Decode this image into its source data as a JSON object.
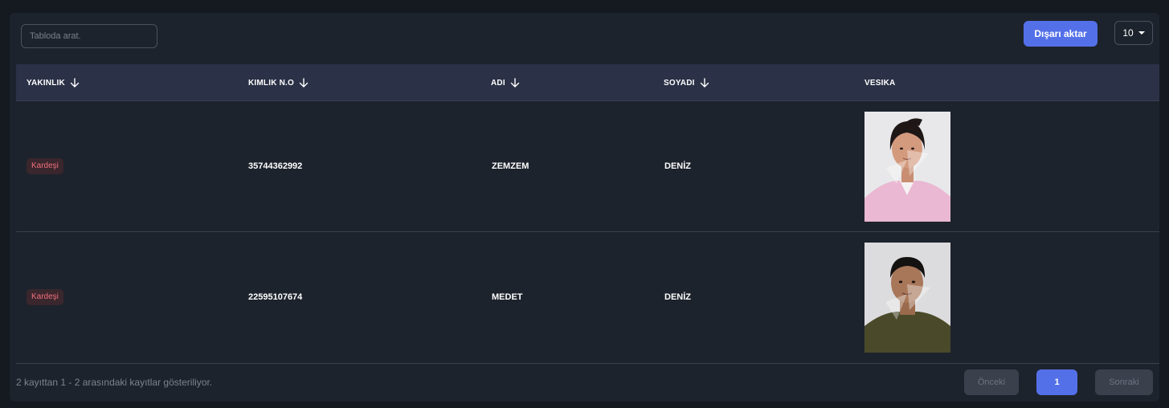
{
  "toolbar": {
    "search_placeholder": "Tabloda arat.",
    "export_label": "Dışarı aktar",
    "page_size": "10"
  },
  "table": {
    "columns": [
      "YAKINLIK",
      "KIMLIK N.O",
      "ADI",
      "SOYADI",
      "VESIKA"
    ],
    "rows": [
      {
        "relation": "Kardeşi",
        "id_no": "35744362992",
        "name": "ZEMZEM",
        "surname": "DENİZ",
        "photo_icon": "portrait-girl-pink-shirt"
      },
      {
        "relation": "Kardeşi",
        "id_no": "22595107674",
        "name": "MEDET",
        "surname": "DENİZ",
        "photo_icon": "portrait-boy-olive-shirt"
      }
    ]
  },
  "footer": {
    "summary": "2 kayıttan 1 - 2 arasındaki kayıtlar gösteriliyor.",
    "prev_label": "Önceki",
    "current_page": "1",
    "next_label": "Sonraki"
  },
  "colors": {
    "accent": "#5470e9",
    "badge_text": "#f0707d",
    "header_bg": "#2b3146",
    "card_bg": "#1d232c"
  }
}
